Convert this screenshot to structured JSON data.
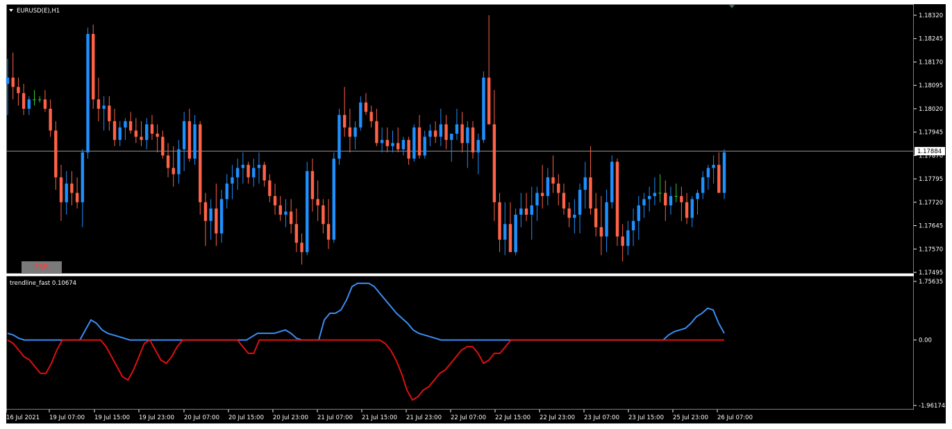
{
  "window": {
    "symbol_label": "EURUSD(E),H1",
    "indicator_label": "trendline_fast 0.10674",
    "fsr_button": "FSR"
  },
  "colors": {
    "background": "#000000",
    "bull": "#1e90ff",
    "bear": "#ff6347",
    "doji": "#32cd32",
    "line_fast": "#3a8ef5",
    "line_slow": "#e01010",
    "grid": "#ffffff",
    "price_line": "#9a9a9a"
  },
  "chart_data": [
    {
      "type": "candlestick",
      "title": "EURUSD(E),H1",
      "y_ticks": [
        "1.18320",
        "1.18245",
        "1.18170",
        "1.18095",
        "1.18020",
        "1.17945",
        "1.17870",
        "1.17795",
        "1.17720",
        "1.17645",
        "1.17570",
        "1.17495"
      ],
      "ylim": [
        1.17495,
        1.1834
      ],
      "current_price": "1.17884",
      "x_ticks": [
        "16 Jul 2021",
        "19 Jul 07:00",
        "19 Jul 15:00",
        "19 Jul 23:00",
        "20 Jul 07:00",
        "20 Jul 15:00",
        "20 Jul 23:00",
        "21 Jul 07:00",
        "21 Jul 15:00",
        "21 Jul 23:00",
        "22 Jul 07:00",
        "22 Jul 15:00",
        "22 Jul 23:00",
        "23 Jul 07:00",
        "23 Jul 15:00",
        "23 Jul 23:00",
        "25 Jul 23:00",
        "26 Jul 07:00"
      ],
      "ohlc": [
        [
          1.181,
          1.1818,
          1.18,
          1.1812
        ],
        [
          1.1812,
          1.182,
          1.1805,
          1.1809
        ],
        [
          1.1809,
          1.1812,
          1.1803,
          1.1807
        ],
        [
          1.1807,
          1.181,
          1.18,
          1.1802
        ],
        [
          1.1802,
          1.1806,
          1.18,
          1.1805
        ],
        [
          1.1805,
          1.1808,
          1.1803,
          1.1805
        ],
        [
          1.1805,
          1.1806,
          1.1804,
          1.1805
        ],
        [
          1.1805,
          1.1808,
          1.1801,
          1.1802
        ],
        [
          1.1802,
          1.1805,
          1.1793,
          1.1795
        ],
        [
          1.1795,
          1.1798,
          1.1776,
          1.178
        ],
        [
          1.178,
          1.1784,
          1.1766,
          1.1772
        ],
        [
          1.1772,
          1.1782,
          1.1768,
          1.1778
        ],
        [
          1.1778,
          1.1782,
          1.1771,
          1.1775
        ],
        [
          1.1775,
          1.178,
          1.177,
          1.1772
        ],
        [
          1.1772,
          1.1789,
          1.1764,
          1.1788
        ],
        [
          1.1788,
          1.1828,
          1.1786,
          1.1826
        ],
        [
          1.1826,
          1.1829,
          1.1802,
          1.1805
        ],
        [
          1.1805,
          1.1812,
          1.1798,
          1.1802
        ],
        [
          1.1802,
          1.1806,
          1.1795,
          1.1803
        ],
        [
          1.1803,
          1.1806,
          1.1795,
          1.1798
        ],
        [
          1.1798,
          1.1802,
          1.179,
          1.1792
        ],
        [
          1.1792,
          1.1798,
          1.179,
          1.1796
        ],
        [
          1.1796,
          1.1799,
          1.1792,
          1.1798
        ],
        [
          1.1798,
          1.1801,
          1.1794,
          1.1795
        ],
        [
          1.1795,
          1.1799,
          1.1791,
          1.1793
        ],
        [
          1.1793,
          1.1798,
          1.179,
          1.1792
        ],
        [
          1.1792,
          1.1799,
          1.1789,
          1.1797
        ],
        [
          1.1797,
          1.18,
          1.1792,
          1.1794
        ],
        [
          1.1794,
          1.1797,
          1.1788,
          1.1793
        ],
        [
          1.1793,
          1.1795,
          1.1786,
          1.1787
        ],
        [
          1.1787,
          1.1791,
          1.178,
          1.1783
        ],
        [
          1.1783,
          1.179,
          1.1777,
          1.1781
        ],
        [
          1.1781,
          1.1792,
          1.1778,
          1.1789
        ],
        [
          1.1789,
          1.1801,
          1.1782,
          1.1798
        ],
        [
          1.1798,
          1.1802,
          1.1785,
          1.1786
        ],
        [
          1.1786,
          1.18,
          1.1784,
          1.1797
        ],
        [
          1.1797,
          1.1798,
          1.1768,
          1.1772
        ],
        [
          1.1772,
          1.1775,
          1.1758,
          1.1766
        ],
        [
          1.1766,
          1.1773,
          1.176,
          1.177
        ],
        [
          1.177,
          1.1778,
          1.1758,
          1.1762
        ],
        [
          1.1762,
          1.1776,
          1.1759,
          1.1773
        ],
        [
          1.1773,
          1.1781,
          1.177,
          1.1778
        ],
        [
          1.1778,
          1.1784,
          1.1773,
          1.178
        ],
        [
          1.178,
          1.1786,
          1.1776,
          1.1783
        ],
        [
          1.1783,
          1.1788,
          1.1778,
          1.1784
        ],
        [
          1.1784,
          1.1785,
          1.1778,
          1.178
        ],
        [
          1.178,
          1.1786,
          1.1777,
          1.1783
        ],
        [
          1.1783,
          1.1788,
          1.1778,
          1.1784
        ],
        [
          1.1784,
          1.1785,
          1.1777,
          1.1779
        ],
        [
          1.1779,
          1.1781,
          1.1772,
          1.1774
        ],
        [
          1.1774,
          1.1778,
          1.1768,
          1.1771
        ],
        [
          1.1771,
          1.1774,
          1.1766,
          1.1768
        ],
        [
          1.1768,
          1.1773,
          1.1764,
          1.1769
        ],
        [
          1.1769,
          1.1773,
          1.1762,
          1.1765
        ],
        [
          1.1765,
          1.177,
          1.1756,
          1.1759
        ],
        [
          1.1759,
          1.1762,
          1.1752,
          1.1756
        ],
        [
          1.1756,
          1.1785,
          1.1755,
          1.1782
        ],
        [
          1.1782,
          1.1786,
          1.1769,
          1.1773
        ],
        [
          1.1773,
          1.1779,
          1.1766,
          1.1771
        ],
        [
          1.1771,
          1.1773,
          1.1762,
          1.1765
        ],
        [
          1.1765,
          1.1773,
          1.1757,
          1.176
        ],
        [
          1.176,
          1.1788,
          1.1759,
          1.1786
        ],
        [
          1.1786,
          1.1802,
          1.1784,
          1.18
        ],
        [
          1.18,
          1.1809,
          1.1793,
          1.1796
        ],
        [
          1.1796,
          1.1802,
          1.1788,
          1.1793
        ],
        [
          1.1793,
          1.1798,
          1.1789,
          1.1796
        ],
        [
          1.1796,
          1.1806,
          1.1795,
          1.1804
        ],
        [
          1.1804,
          1.1807,
          1.18,
          1.1801
        ],
        [
          1.1801,
          1.1803,
          1.1796,
          1.1798
        ],
        [
          1.1798,
          1.1802,
          1.179,
          1.1791
        ],
        [
          1.1791,
          1.1796,
          1.1788,
          1.1792
        ],
        [
          1.1792,
          1.1796,
          1.1788,
          1.179
        ],
        [
          1.179,
          1.1795,
          1.1788,
          1.1791
        ],
        [
          1.1791,
          1.1796,
          1.1788,
          1.1789
        ],
        [
          1.1789,
          1.1793,
          1.1787,
          1.1792
        ],
        [
          1.1792,
          1.1793,
          1.1784,
          1.1786
        ],
        [
          1.1786,
          1.1797,
          1.1785,
          1.1796
        ],
        [
          1.1796,
          1.18,
          1.1786,
          1.1787
        ],
        [
          1.1787,
          1.1795,
          1.1786,
          1.1793
        ],
        [
          1.1793,
          1.1797,
          1.179,
          1.1795
        ],
        [
          1.1795,
          1.1798,
          1.1791,
          1.1793
        ],
        [
          1.1793,
          1.1802,
          1.179,
          1.1797
        ],
        [
          1.1797,
          1.18,
          1.1789,
          1.1792
        ],
        [
          1.1792,
          1.1794,
          1.1785,
          1.1794
        ],
        [
          1.1794,
          1.1802,
          1.1792,
          1.1797
        ],
        [
          1.1797,
          1.1801,
          1.1788,
          1.1791
        ],
        [
          1.1791,
          1.1798,
          1.1783,
          1.1796
        ],
        [
          1.1796,
          1.1798,
          1.1786,
          1.1788
        ],
        [
          1.1788,
          1.1794,
          1.1781,
          1.1792
        ],
        [
          1.1792,
          1.1814,
          1.1791,
          1.1812
        ],
        [
          1.1812,
          1.1832,
          1.1797,
          1.1797
        ],
        [
          1.1797,
          1.1808,
          1.1766,
          1.1772
        ],
        [
          1.1772,
          1.1775,
          1.1756,
          1.176
        ],
        [
          1.176,
          1.1772,
          1.1755,
          1.1765
        ],
        [
          1.1765,
          1.1772,
          1.1756,
          1.1756
        ],
        [
          1.1756,
          1.177,
          1.1755,
          1.1768
        ],
        [
          1.1768,
          1.1775,
          1.1764,
          1.177
        ],
        [
          1.177,
          1.1775,
          1.1766,
          1.1768
        ],
        [
          1.1768,
          1.1777,
          1.176,
          1.1771
        ],
        [
          1.1771,
          1.1777,
          1.1766,
          1.1775
        ],
        [
          1.1775,
          1.1784,
          1.177,
          1.1774
        ],
        [
          1.1774,
          1.1783,
          1.1771,
          1.178
        ],
        [
          1.178,
          1.1787,
          1.1775,
          1.1778
        ],
        [
          1.1778,
          1.1781,
          1.1771,
          1.1775
        ],
        [
          1.1775,
          1.1778,
          1.1768,
          1.177
        ],
        [
          1.177,
          1.1772,
          1.1764,
          1.1767
        ],
        [
          1.1767,
          1.1773,
          1.1762,
          1.1768
        ],
        [
          1.1768,
          1.1778,
          1.1762,
          1.1776
        ],
        [
          1.1776,
          1.1785,
          1.177,
          1.178
        ],
        [
          1.178,
          1.179,
          1.1768,
          1.177
        ],
        [
          1.177,
          1.1775,
          1.1761,
          1.1764
        ],
        [
          1.1764,
          1.1774,
          1.1755,
          1.1761
        ],
        [
          1.1761,
          1.1776,
          1.1756,
          1.1772
        ],
        [
          1.1772,
          1.1787,
          1.177,
          1.1785
        ],
        [
          1.1785,
          1.1786,
          1.1758,
          1.1761
        ],
        [
          1.1761,
          1.1765,
          1.1753,
          1.1758
        ],
        [
          1.1758,
          1.1766,
          1.1755,
          1.1763
        ],
        [
          1.1763,
          1.177,
          1.1758,
          1.1766
        ],
        [
          1.1766,
          1.1774,
          1.176,
          1.1771
        ],
        [
          1.1771,
          1.1775,
          1.1767,
          1.1773
        ],
        [
          1.1773,
          1.1777,
          1.1769,
          1.1774
        ],
        [
          1.1774,
          1.178,
          1.1771,
          1.1775
        ],
        [
          1.1775,
          1.1781,
          1.1772,
          1.1775
        ],
        [
          1.1775,
          1.1779,
          1.1766,
          1.1771
        ],
        [
          1.1771,
          1.1777,
          1.1768,
          1.1774
        ],
        [
          1.1774,
          1.1778,
          1.1772,
          1.1774
        ],
        [
          1.1774,
          1.1777,
          1.1766,
          1.1772
        ],
        [
          1.1772,
          1.1775,
          1.1765,
          1.1767
        ],
        [
          1.1767,
          1.1774,
          1.1764,
          1.1773
        ],
        [
          1.1773,
          1.1776,
          1.1768,
          1.1775
        ],
        [
          1.1775,
          1.1782,
          1.1773,
          1.178
        ],
        [
          1.178,
          1.1784,
          1.1776,
          1.1783
        ],
        [
          1.1783,
          1.1787,
          1.1778,
          1.1784
        ],
        [
          1.1784,
          1.1788,
          1.1775,
          1.1775
        ],
        [
          1.1775,
          1.1789,
          1.1773,
          1.1788
        ]
      ],
      "xlabel": "",
      "ylabel": ""
    },
    {
      "type": "line",
      "title": "trendline_fast 0.10674",
      "y_ticks": [
        "1.75635",
        "0.00",
        "-1.96174"
      ],
      "ylim": [
        -1.96174,
        1.75635
      ],
      "series": [
        {
          "values": [
            0.2,
            0.15,
            0.05,
            0,
            0,
            0,
            0,
            0,
            0,
            0,
            0,
            0,
            0,
            0,
            0.3,
            0.6,
            0.5,
            0.3,
            0.2,
            0.15,
            0.1,
            0.05,
            0,
            0,
            0,
            0,
            0,
            0,
            0,
            0,
            0,
            0,
            0,
            0,
            0,
            0,
            0,
            0,
            0,
            0,
            0,
            0,
            0,
            0,
            0.1,
            0.2,
            0.2,
            0.2,
            0.2,
            0.25,
            0.3,
            0.2,
            0.05,
            0,
            0,
            0,
            0,
            0.6,
            0.8,
            0.8,
            0.9,
            1.2,
            1.6,
            1.7,
            1.7,
            1.7,
            1.6,
            1.4,
            1.2,
            1.0,
            0.8,
            0.65,
            0.5,
            0.3,
            0.2,
            0.15,
            0.1,
            0.05,
            0,
            0,
            0,
            0,
            0,
            0,
            0,
            0,
            0,
            0,
            0,
            0,
            0,
            0,
            0,
            0,
            0,
            0,
            0,
            0,
            0,
            0,
            0,
            0,
            0,
            0,
            0,
            0,
            0,
            0,
            0,
            0,
            0,
            0,
            0,
            0,
            0,
            0,
            0,
            0,
            0,
            0.15,
            0.25,
            0.3,
            0.35,
            0.5,
            0.7,
            0.8,
            0.95,
            0.9,
            0.5,
            0.2
          ]
        },
        {
          "values": [
            0,
            -0.1,
            -0.3,
            -0.5,
            -0.6,
            -0.8,
            -1.0,
            -1.0,
            -0.7,
            -0.3,
            0,
            0,
            0,
            0,
            0,
            0,
            0,
            0,
            -0.2,
            -0.5,
            -0.8,
            -1.1,
            -1.2,
            -0.9,
            -0.5,
            -0.1,
            0,
            -0.3,
            -0.6,
            -0.7,
            -0.5,
            -0.2,
            0,
            0,
            0,
            0,
            0,
            0,
            0,
            0,
            0,
            0,
            0,
            -0.2,
            -0.4,
            -0.4,
            0,
            0,
            0,
            0,
            0,
            0,
            0,
            0,
            0,
            0,
            0,
            0,
            0,
            0,
            0,
            0,
            0,
            0,
            0,
            0,
            0,
            0,
            0,
            -0.1,
            -0.3,
            -0.6,
            -1.0,
            -1.5,
            -1.8,
            -1.7,
            -1.5,
            -1.4,
            -1.2,
            -1.0,
            -0.9,
            -0.7,
            -0.5,
            -0.3,
            -0.2,
            -0.2,
            -0.4,
            -0.7,
            -0.6,
            -0.4,
            -0.4,
            -0.2,
            0,
            0,
            0,
            0,
            0,
            0,
            0,
            0,
            0,
            0,
            0,
            0,
            0,
            0,
            0,
            0,
            0,
            0,
            0,
            0,
            0,
            0,
            0,
            0,
            0,
            0,
            0,
            0,
            0,
            0,
            0,
            0,
            0,
            0,
            0,
            0,
            0,
            0,
            0,
            0
          ]
        }
      ],
      "xlabel": "",
      "ylabel": ""
    }
  ]
}
